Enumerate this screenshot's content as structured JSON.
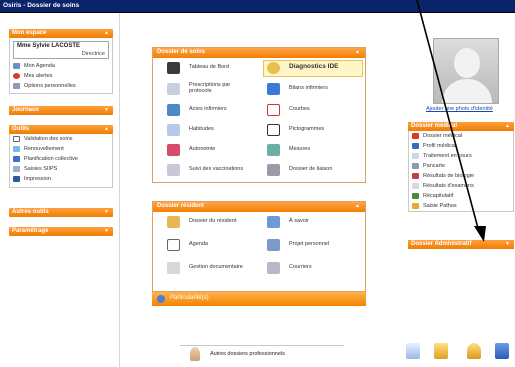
{
  "window": {
    "title": "Osiris - Dossier de soins"
  },
  "left": {
    "mon_espace": {
      "title": "Mon espace",
      "user_name": "Mme Sylvie LACOSTE",
      "user_role": "Directrice",
      "items": [
        "Mon Agenda",
        "Mes alertes",
        "Options personnelles"
      ]
    },
    "journaux": {
      "title": "Journaux"
    },
    "outils": {
      "title": "Outils",
      "items": [
        "Validation des soins",
        "Renouvellement",
        "Planification collective",
        "Saisies SIIPS",
        "Impression"
      ]
    },
    "autres_outils": {
      "title": "Autres outils"
    },
    "parametrage": {
      "title": "Paramétrage"
    }
  },
  "dossier_soins": {
    "title": "Dossier de soins",
    "items": [
      "Tableau de Bord",
      "Diagnostics IDE",
      "Prescriptions par protocole",
      "Bilans infirmiers",
      "Actes infirmiers",
      "Courbes",
      "Habitudes",
      "Pictogrammes",
      "Autonomie",
      "Mesures",
      "Suivi des vaccinations",
      "Dossier de liaison"
    ]
  },
  "dossier_resident": {
    "title": "Dossier résident",
    "items": [
      "Dossier du résident",
      "À savoir",
      "Agenda",
      "Projet personnel",
      "Gestion documentaire",
      "Courriers"
    ],
    "particularites": "Particularité(s)"
  },
  "right": {
    "photo_link": "Ajouter une photo d'identité",
    "dossier_medical": {
      "title": "Dossier médical",
      "items": [
        "Dossier médical",
        "Profil médical",
        "Traitement en cours",
        "Pancarte",
        "Résultats de biologie",
        "Résultats d'examens",
        "Récapitulatif",
        "Saisie Pathos"
      ]
    },
    "dossier_administratif": {
      "title": "Dossier Administratif"
    }
  },
  "bottom": {
    "autres_dossiers": "Autres dossiers professionnels"
  },
  "colors": {
    "orange": "#f47f00",
    "titlebar": "#0a246a"
  }
}
